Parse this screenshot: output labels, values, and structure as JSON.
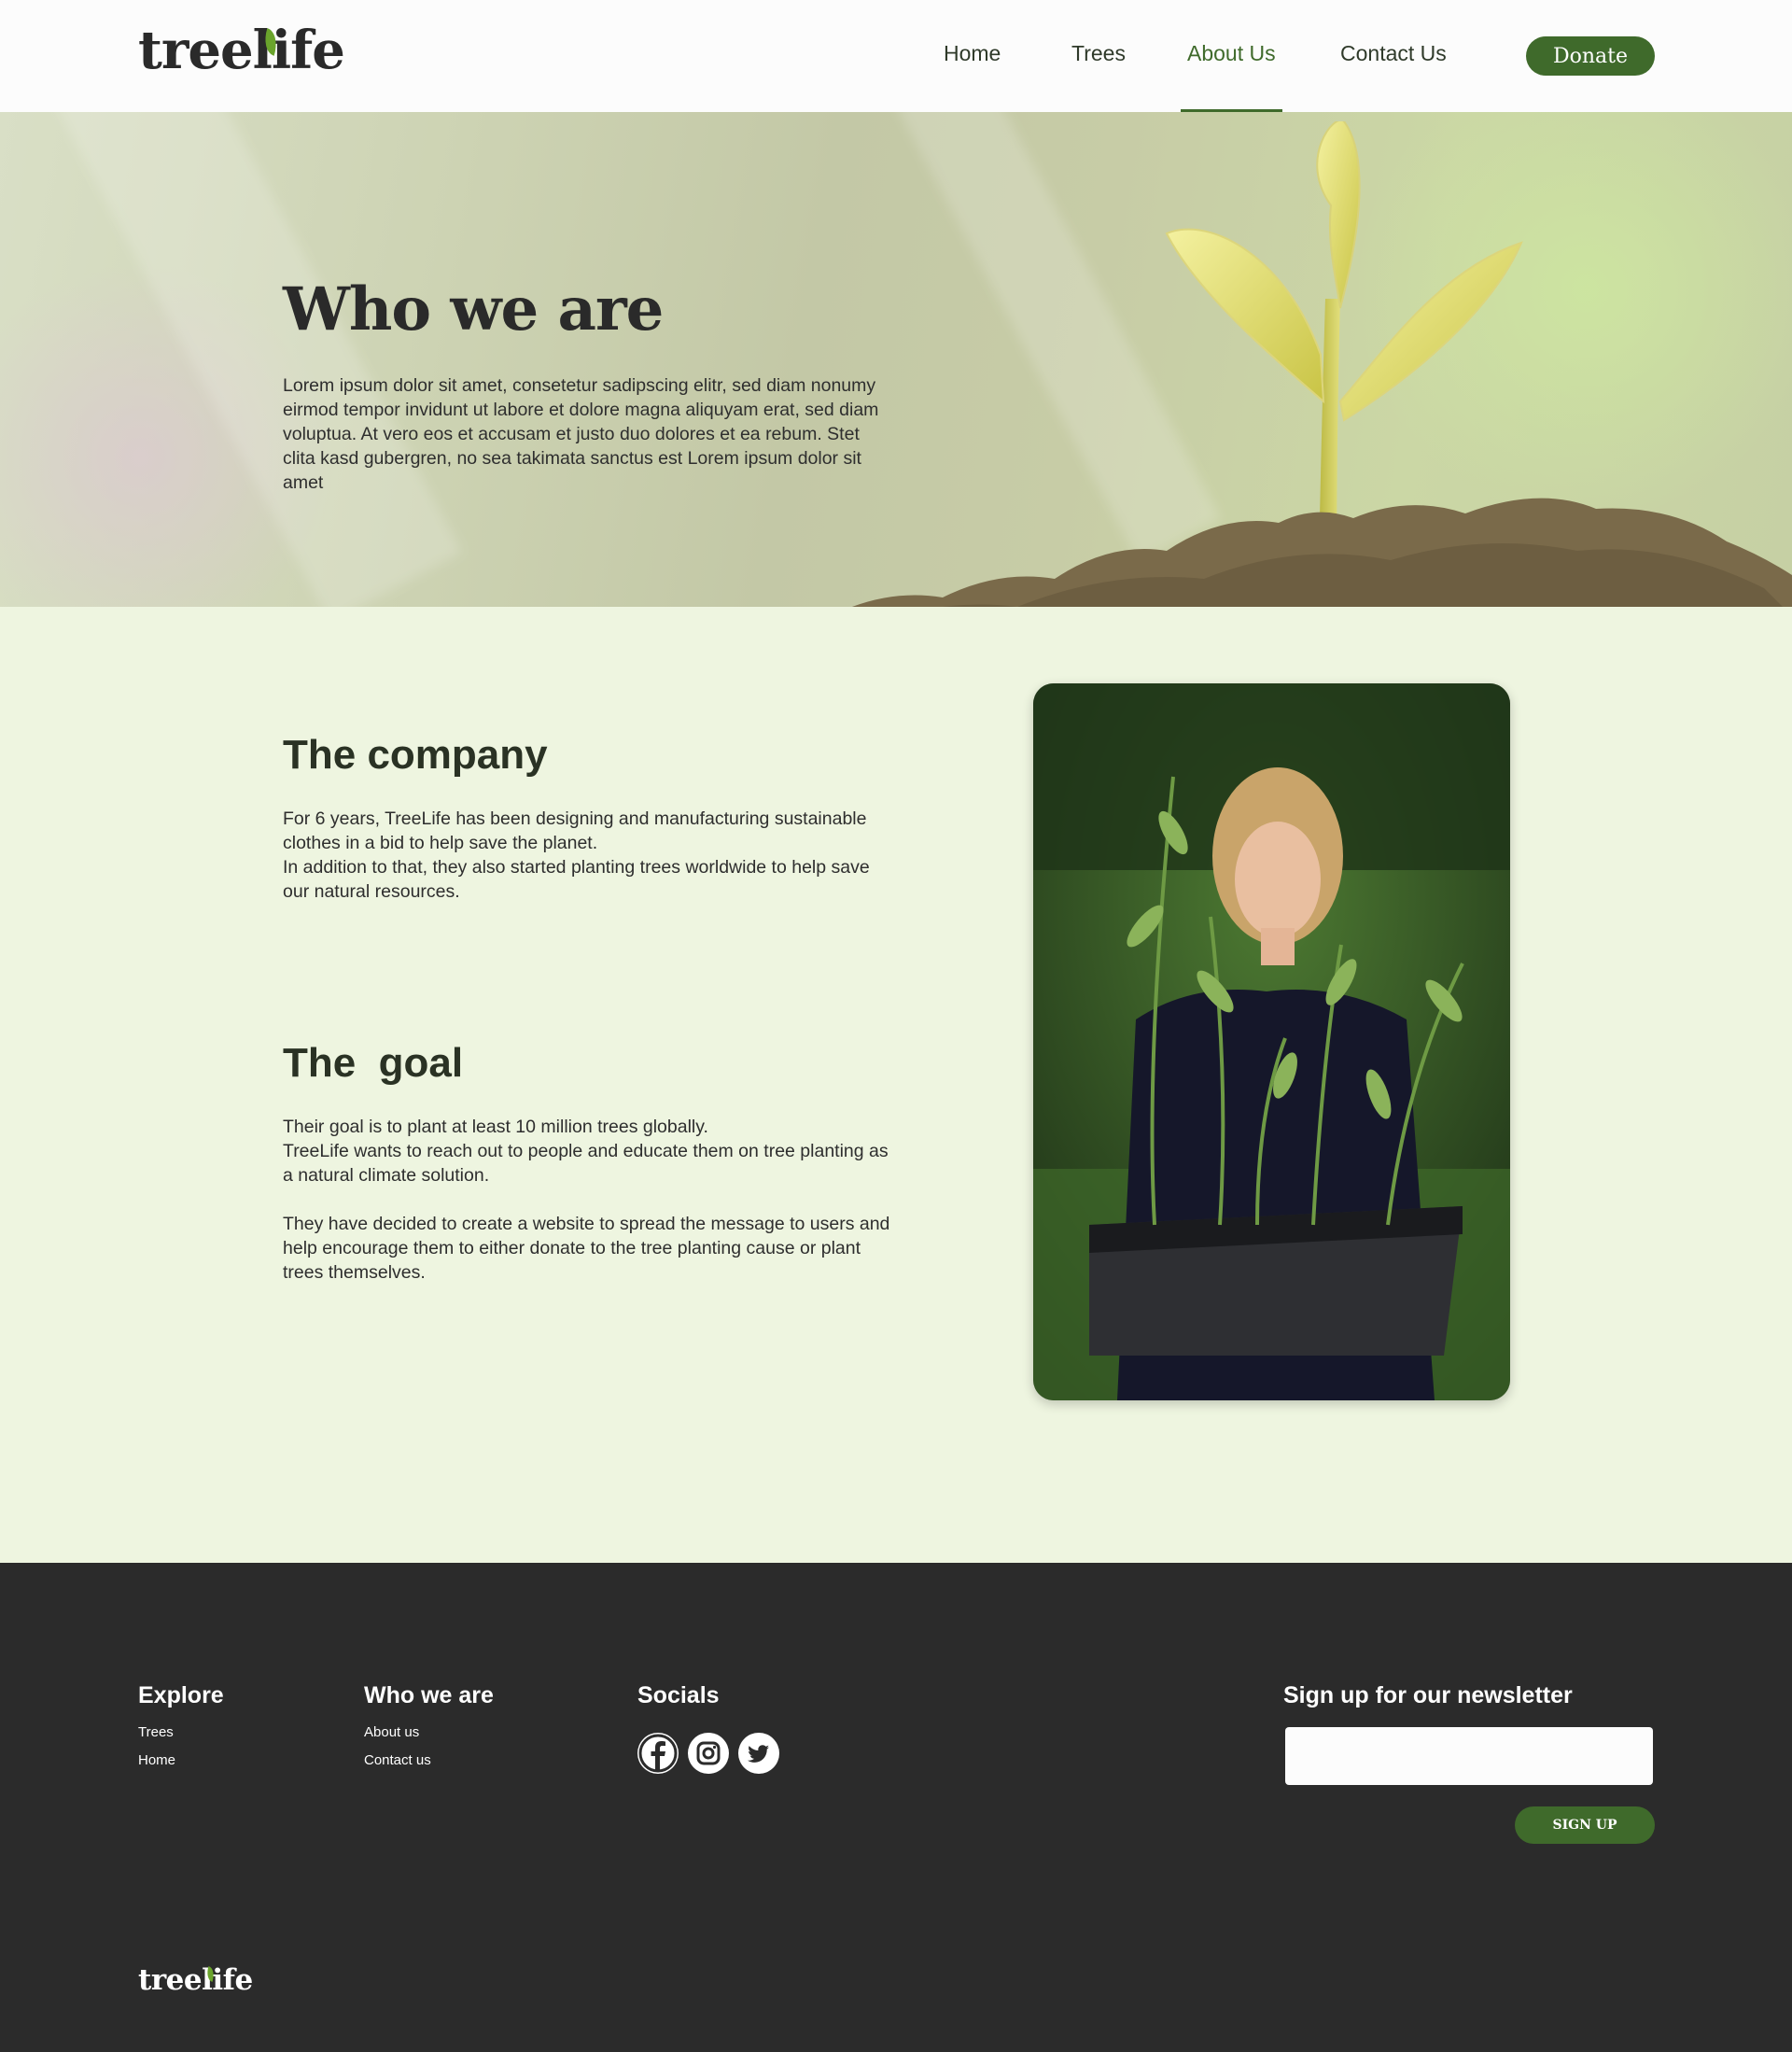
{
  "brand": {
    "name": "treelife",
    "accent": "#3f6a2b",
    "leaf_color": "#6aa42c"
  },
  "nav": {
    "items": [
      {
        "label": "Home"
      },
      {
        "label": "Trees"
      },
      {
        "label": "About Us",
        "active": true
      },
      {
        "label": "Contact Us"
      }
    ],
    "donate_label": "Donate"
  },
  "hero": {
    "title": "Who we are",
    "text": "Lorem ipsum dolor sit amet, consetetur sadipscing elitr, sed diam nonumy eirmod tempor invidunt ut labore et dolore magna aliquyam erat, sed diam voluptua. At vero eos et accusam et justo duo dolores et ea rebum. Stet clita kasd gubergren, no sea takimata sanctus est Lorem ipsum dolor sit amet",
    "image": "sprout-in-soil"
  },
  "company": {
    "title": "The company",
    "p1": "For 6 years, TreeLife has been designing and manufacturing sustainable clothes in a bid to help save the planet.",
    "p2": "In addition to that, they also started planting trees worldwide to help save our natural resources."
  },
  "goal": {
    "title": "The  goal",
    "p1": "Their goal is to plant at least 10 million trees globally.",
    "p2": "TreeLife wants to reach out to people and educate them on tree planting as a natural climate solution.",
    "p3": "They have decided to create a website to spread the message to users and help encourage them to either donate to the tree planting cause or plant trees themselves."
  },
  "photo": {
    "subject": "woman-holding-seedling-tray"
  },
  "footer": {
    "explore": {
      "title": "Explore",
      "links": [
        "Trees",
        "Home"
      ]
    },
    "who": {
      "title": "Who we are",
      "links": [
        "About us",
        "Contact us"
      ]
    },
    "socials": {
      "title": "Socials",
      "icons": [
        "facebook-icon",
        "instagram-icon",
        "twitter-icon"
      ]
    },
    "newsletter": {
      "title": "Sign up for our newsletter",
      "input_value": "",
      "button_label": "SIGN UP"
    },
    "logo": "treelife"
  }
}
